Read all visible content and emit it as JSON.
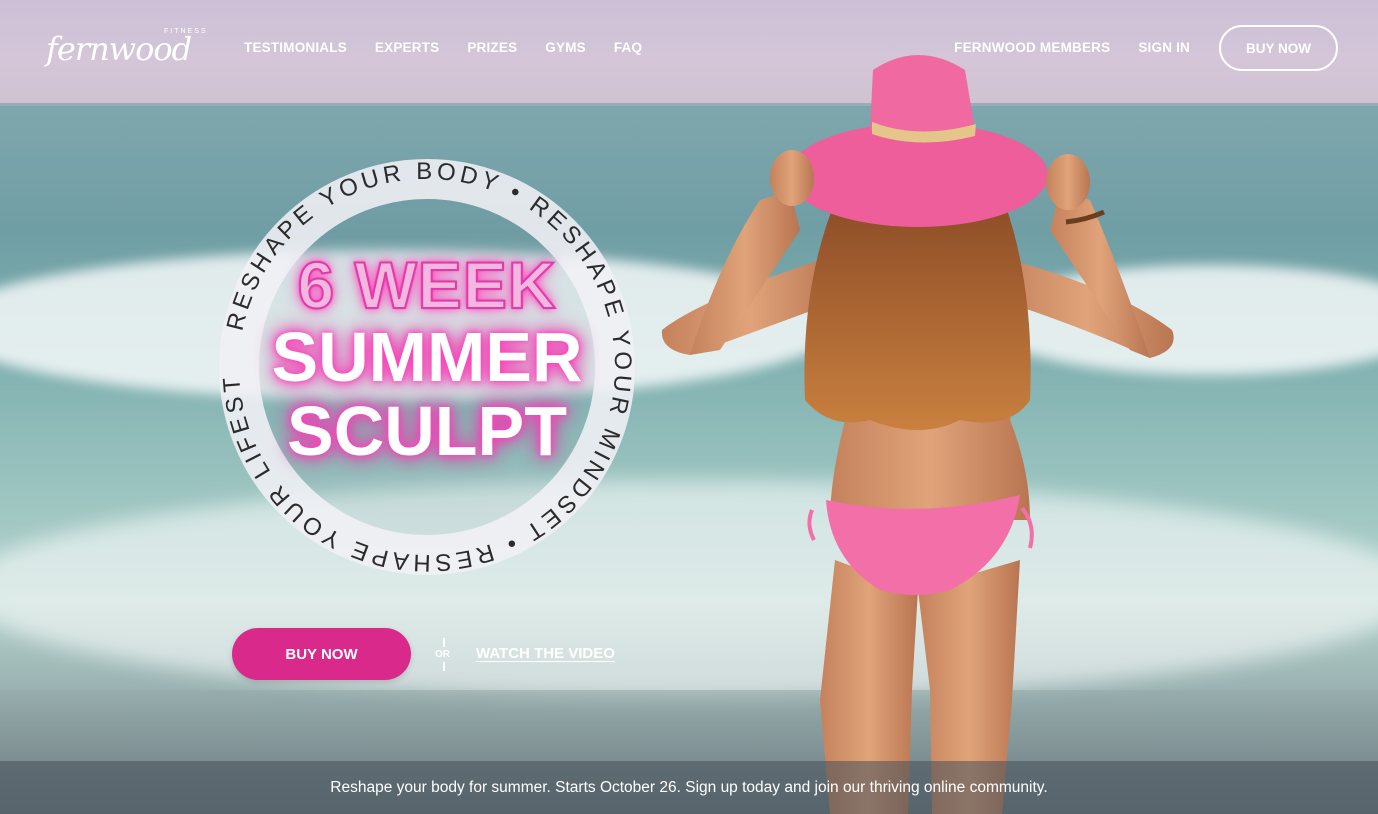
{
  "header": {
    "logo": {
      "brand": "fernwood",
      "tag": "FITNESS"
    },
    "nav": [
      "TESTIMONIALS",
      "EXPERTS",
      "PRIZES",
      "GYMS",
      "FAQ"
    ],
    "nav_right": [
      "FERNWOOD MEMBERS",
      "SIGN IN"
    ],
    "buy_button": "BUY NOW"
  },
  "badge": {
    "ring_text": "RESHAPE YOUR BODY • RESHAPE YOUR MINDSET • RESHAPE YOUR LIFESTYLE •",
    "headline": [
      "6 WEEK",
      "SUMMER",
      "SCULPT"
    ]
  },
  "cta": {
    "buy_button": "BUY NOW",
    "or": "OR",
    "watch_link": "WATCH THE VIDEO"
  },
  "footer": {
    "tagline": "Reshape your body for summer. Starts October 26. Sign up today and join our thriving online community."
  },
  "colors": {
    "accent": "#d92a8c",
    "hat": "#ee5e9b",
    "bikini": "#f36fa8"
  }
}
